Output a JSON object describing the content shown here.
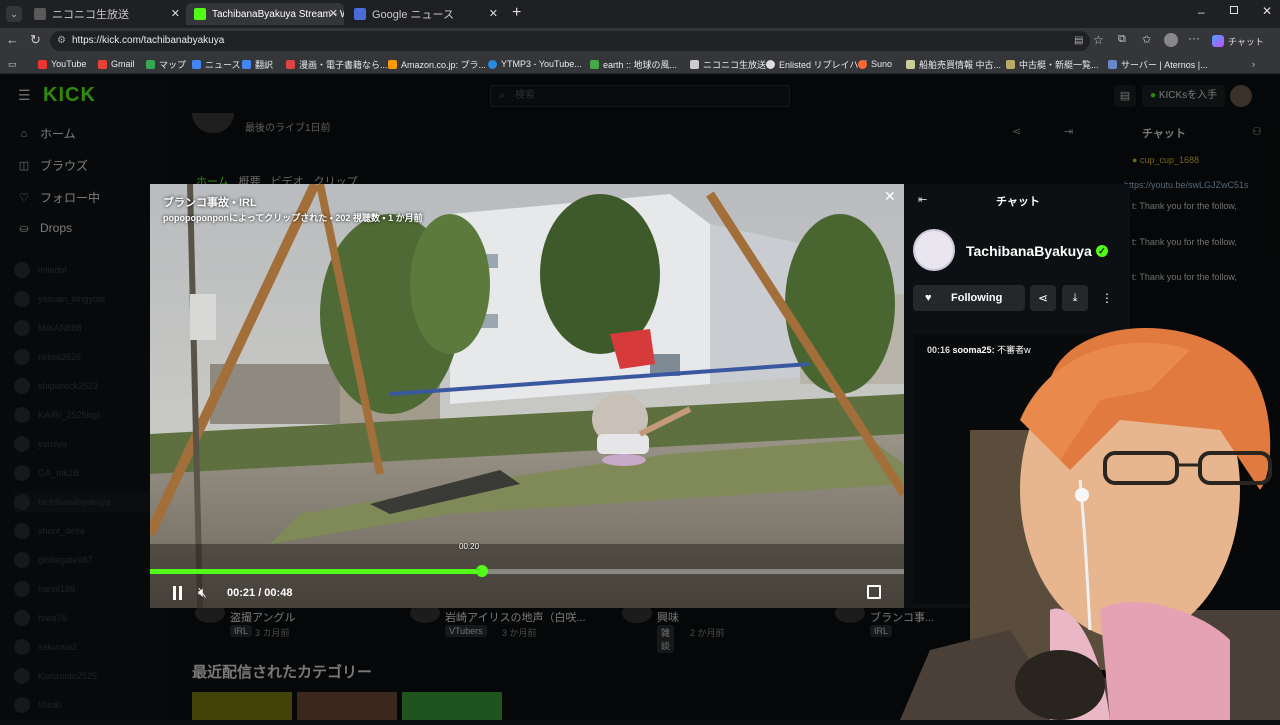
{
  "browser": {
    "tabs": [
      {
        "title": "ニコニコ生放送",
        "active": false,
        "color": "#5a5a5a"
      },
      {
        "title": "TachibanaByakuya Stream - Watch",
        "active": true,
        "color": "#53fc18"
      },
      {
        "title": "Google ニュース",
        "active": false,
        "color": "#4a6ad8"
      }
    ],
    "url": "https://kick.com/tachibanabyakuya",
    "profile_label": "チャット",
    "bookmarks": [
      "YouTube",
      "Gmail",
      "マップ",
      "ニュース",
      "翻訳",
      "漫画・電子書籍なら...",
      "Amazon.co.jp: プラ...",
      "YTMP3 - YouTube...",
      "earth :: 地球の風...",
      "ニコニコ生放送",
      "Enlisted リプレイハブ",
      "Suno",
      "船舶売買情報 中古...",
      "中古艇・新艇一覧...",
      "サーバー | Aternos |..."
    ]
  },
  "kick": {
    "logo": "KICK",
    "search_placeholder": "検索",
    "kicks_button": "KICKsを入手",
    "nav": [
      {
        "label": "ホーム",
        "icon": "home-icon"
      },
      {
        "label": "ブラウズ",
        "icon": "browse-icon"
      },
      {
        "label": "フォロー中",
        "icon": "heart-icon"
      },
      {
        "label": "Drops",
        "icon": "drops-icon"
      }
    ],
    "following": [
      "miledot",
      "yasuan_kingyoid",
      "MIKAN888",
      "nkiwa2626",
      "shipwreck2523",
      "KAIRI_2525kgs",
      "yomiyu",
      "GA_mk2B",
      "tachibanabyakuya",
      "shoot_delta",
      "globegate987",
      "hanni198",
      "hiwa75",
      "sakuraia2",
      "Kurumoto2525",
      "Mitoki"
    ],
    "channel_last_live": "最後のライブ1日前",
    "channel_tabs": [
      "ホーム",
      "概要",
      "ビデオ",
      "クリップ"
    ],
    "bg_clips": [
      {
        "title": "盗撮アングル",
        "tag": "IRL",
        "age": "3 カ月前"
      },
      {
        "title": "岩崎アイリスの地声（白咲...",
        "tag": "VTubers",
        "age": "3 か月前"
      },
      {
        "title": "興味",
        "tag": "雑談",
        "age": "2 か月前"
      },
      {
        "title": "ブランコ事...",
        "tag": "IRL",
        "age": ""
      }
    ],
    "recent_categories_title": "最近配信されたカテゴリー",
    "bg_chat_title": "チャット",
    "bg_chat_lines": [
      {
        "user": "cup_cup_1688",
        "text": ""
      },
      {
        "user": "",
        "text": "https://youtu.be/swLGJZwC51s"
      },
      {
        "user": "",
        "text": "t: Thank you for the follow,"
      },
      {
        "user": "",
        "text": "t: Thank you for the follow,"
      },
      {
        "user": "",
        "text": "t: Thank you for the follow,"
      }
    ]
  },
  "clip": {
    "title": "ブランコ事故 • IRL",
    "meta": "popopoponponによってクリップされた • 202 視聴数 • 1 か月前",
    "hover_time": "00:20",
    "time_display": "00:21 / 00:48",
    "progress": 0.44
  },
  "chat_panel": {
    "title": "チャット",
    "streamer": "TachibanaByakuya",
    "follow_label": "Following",
    "message": {
      "time": "00:16",
      "user": "sooma25:",
      "text": "不審者w"
    }
  },
  "colors": {
    "accent": "#53fc18",
    "verified": "#53fc18",
    "bg": "#0b0e0f"
  }
}
